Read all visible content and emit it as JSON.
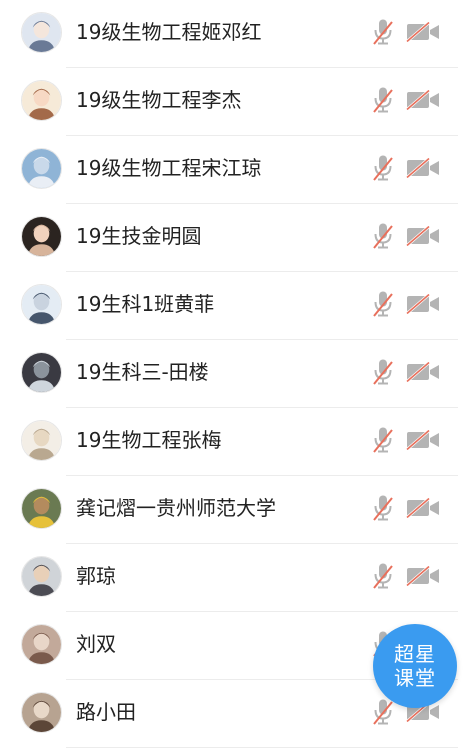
{
  "participants": [
    {
      "name": "19级生物工程姬邓红",
      "avatar": "anime-girl-avatar",
      "mic": "muted-mic-icon",
      "camera": "camera-off-icon"
    },
    {
      "name": "19级生物工程李杰",
      "avatar": "cartoon-girl-avatar",
      "mic": "muted-mic-icon",
      "camera": "camera-off-icon"
    },
    {
      "name": "19级生物工程宋江琼",
      "avatar": "sky-avatar",
      "mic": "muted-mic-icon",
      "camera": "camera-off-icon"
    },
    {
      "name": "19生技金明圆",
      "avatar": "portrait-avatar",
      "mic": "muted-mic-icon",
      "camera": "camera-off-icon"
    },
    {
      "name": "19生科1班黄菲",
      "avatar": "portrait-avatar",
      "mic": "muted-mic-icon",
      "camera": "camera-off-icon"
    },
    {
      "name": "19生科三-田楼",
      "avatar": "dark-artwork-avatar",
      "mic": "muted-mic-icon",
      "camera": "camera-off-icon"
    },
    {
      "name": "19生物工程张梅",
      "avatar": "sketch-avatar",
      "mic": "muted-mic-icon",
      "camera": "camera-off-icon"
    },
    {
      "name": "龚记熠一贵州师范大学",
      "avatar": "photo-avatar",
      "mic": "muted-mic-icon",
      "camera": "camera-off-icon"
    },
    {
      "name": "郭琼",
      "avatar": "portrait-avatar",
      "mic": "muted-mic-icon",
      "camera": "camera-off-icon"
    },
    {
      "name": "刘双",
      "avatar": "photo-avatar",
      "mic": "muted-mic-icon",
      "camera": "camera-off-icon"
    },
    {
      "name": "路小田",
      "avatar": "photo-avatar",
      "mic": "muted-mic-icon",
      "camera": "camera-off-icon"
    }
  ],
  "fab": {
    "line1": "超星",
    "line2": "课堂"
  },
  "colors": {
    "accent": "#3a9bf0",
    "icon_gray": "#b4b4b4",
    "slash_red": "#e8705c",
    "text": "#222222"
  }
}
